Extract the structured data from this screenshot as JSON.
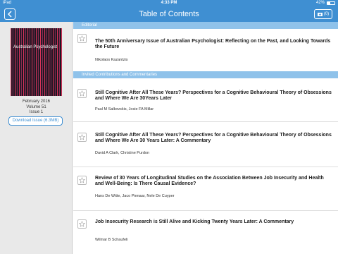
{
  "status_bar": {
    "carrier": "iPad",
    "time": "4:33 PM",
    "battery": "42%",
    "battery_fraction": 0.42
  },
  "nav": {
    "title": "Table of Contents",
    "back_icon": "chevron-left-icon",
    "download_count": "(0)",
    "download_icon": "download-icon"
  },
  "issue": {
    "cover_title": "Australian Psychologist",
    "date": "February 2016",
    "volume": "Volume 51",
    "number": "Issue 1",
    "download_label": "Download Issue (6.3MB)"
  },
  "sections": [
    {
      "name": "Editorial"
    },
    {
      "name": "Invited Contributions and Commentaries"
    }
  ],
  "articles": [
    {
      "title": "The 50th Anniversary Issue of Australian Psychologist: Reflecting on the Past, and Looking Towards the Future",
      "authors": "Nikolaos Kazantzis"
    },
    {
      "title": "Still Cognitive After All These Years? Perspectives for a Cognitive Behavioural Theory of Obsessions and Where We Are 30Years Later",
      "authors": "Paul M Salkovskis, Josie FA Millar"
    },
    {
      "title": "Still Cognitive After All These Years? Perspectives for a Cognitive Behavioural Theory of Obsessions and Where We Are 30 Years Later: A Commentary",
      "authors": "David A Clark, Christine Purdon"
    },
    {
      "title": "Review of 30 Years of Longitudinal Studies on the Association Between Job Insecurity and Health and Well-Being: Is There Causal Evidence?",
      "authors": "Hans De Witte, Jaco Pienaar, Nele De Cuyper"
    },
    {
      "title": "Job Insecurity Research is Still Alive and Kicking Twenty Years Later: A Commentary",
      "authors": "Wilmar B Schaufeli"
    }
  ],
  "colors": {
    "accent": "#3f8fd2",
    "section_header": "#8fc2ea",
    "sidebar": "#e9e9e9"
  }
}
